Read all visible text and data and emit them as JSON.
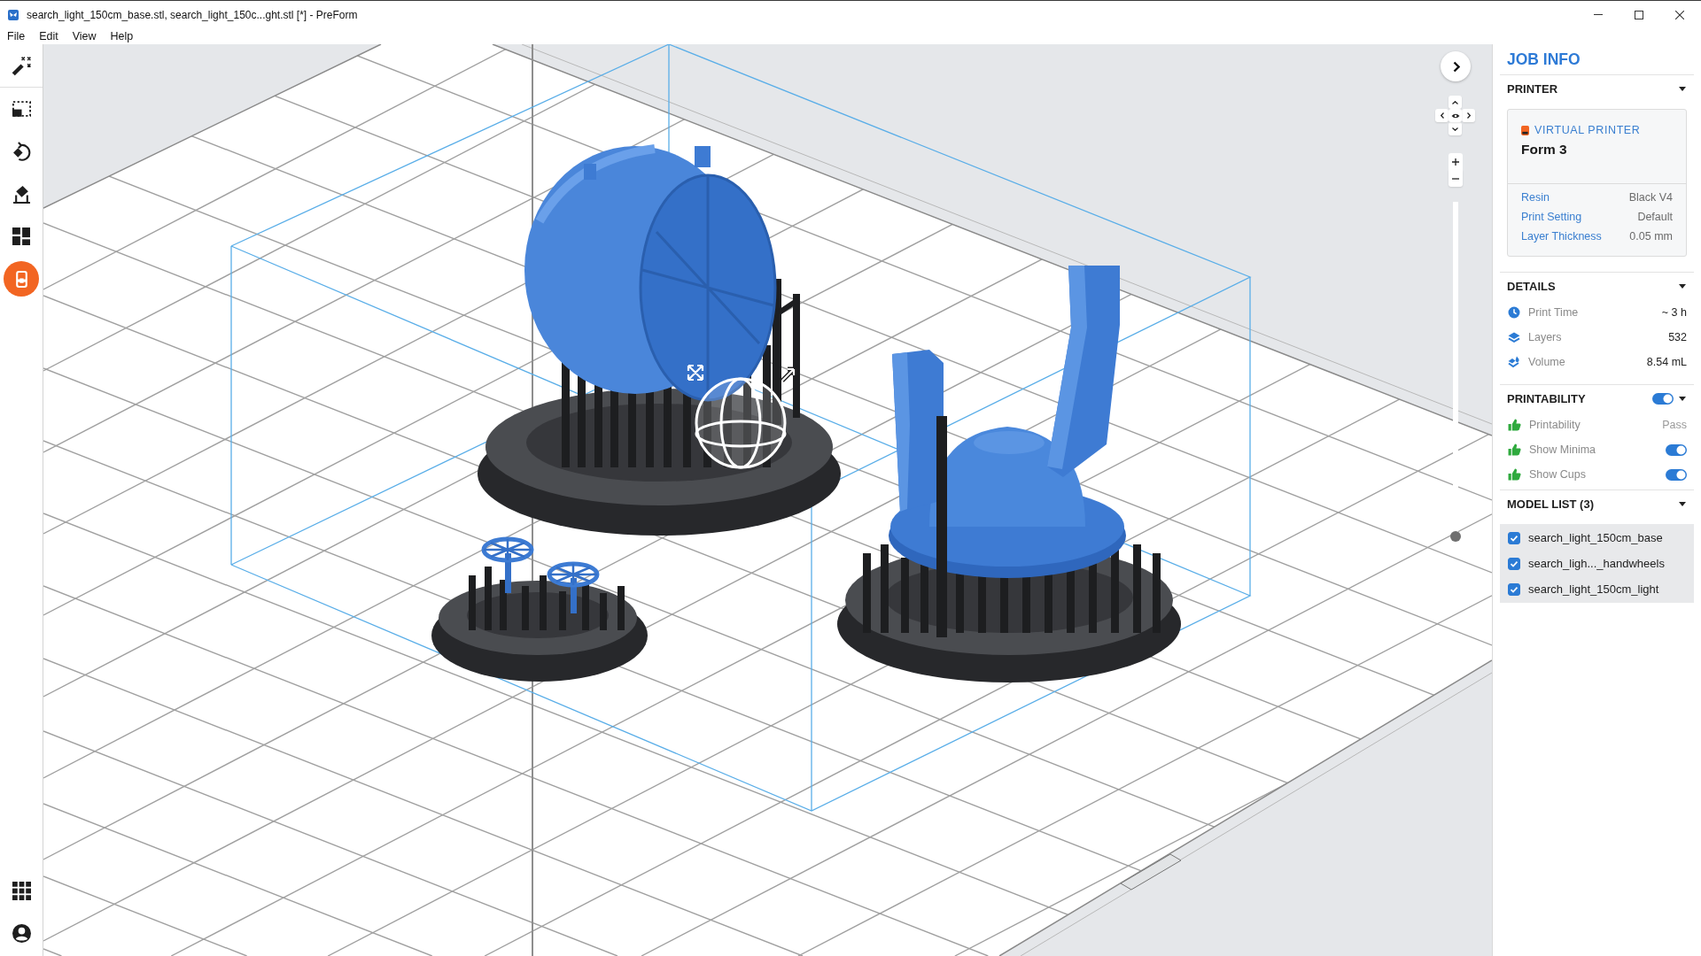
{
  "window": {
    "title": "search_light_150cm_base.stl, search_light_150c...ght.stl [*] - PreForm"
  },
  "menu": [
    {
      "label": "File"
    },
    {
      "label": "Edit"
    },
    {
      "label": "View"
    },
    {
      "label": "Help"
    }
  ],
  "toolbar": {
    "tools": [
      {
        "kind": "wand",
        "selected": false
      },
      {
        "kind": "select",
        "selected": false
      },
      {
        "kind": "orient",
        "selected": false
      },
      {
        "kind": "supports",
        "selected": false
      },
      {
        "kind": "layout",
        "selected": false
      },
      {
        "kind": "print",
        "selected": true
      }
    ],
    "bottom": [
      {
        "kind": "apps"
      },
      {
        "kind": "account"
      }
    ]
  },
  "viewport": {
    "layer_slider": {
      "level": 0
    }
  },
  "job_info": {
    "title": "JOB INFO",
    "printer": {
      "heading": "PRINTER",
      "expanded": true,
      "badge": "VIRTUAL PRINTER",
      "name": "Form 3",
      "settings": [
        {
          "label": "Resin",
          "value": "Black V4"
        },
        {
          "label": "Print Setting",
          "value": "Default"
        },
        {
          "label": "Layer Thickness",
          "value": "0.05 mm"
        }
      ]
    },
    "details": {
      "heading": "DETAILS",
      "expanded": true,
      "rows": [
        {
          "kind": "clock",
          "label": "Print Time",
          "value": "~ 3 h"
        },
        {
          "kind": "layers",
          "label": "Layers",
          "value": "532"
        },
        {
          "kind": "volume",
          "label": "Volume",
          "value": "8.54 mL"
        }
      ]
    },
    "printability": {
      "heading": "PRINTABILITY",
      "on": true,
      "expanded": true,
      "rows": [
        {
          "kind": "status",
          "label": "Printability",
          "value": "Pass"
        },
        {
          "kind": "toggle",
          "label": "Show Minima",
          "on": true
        },
        {
          "kind": "toggle",
          "label": "Show Cups",
          "on": true
        }
      ]
    },
    "model_list": {
      "heading": "MODEL LIST (3)",
      "expanded": true,
      "items": [
        {
          "name": "search_light_150cm_base",
          "checked": true
        },
        {
          "name": "search_ligh..._handwheels",
          "checked": true
        },
        {
          "name": "search_light_150cm_light",
          "checked": true
        }
      ]
    }
  }
}
